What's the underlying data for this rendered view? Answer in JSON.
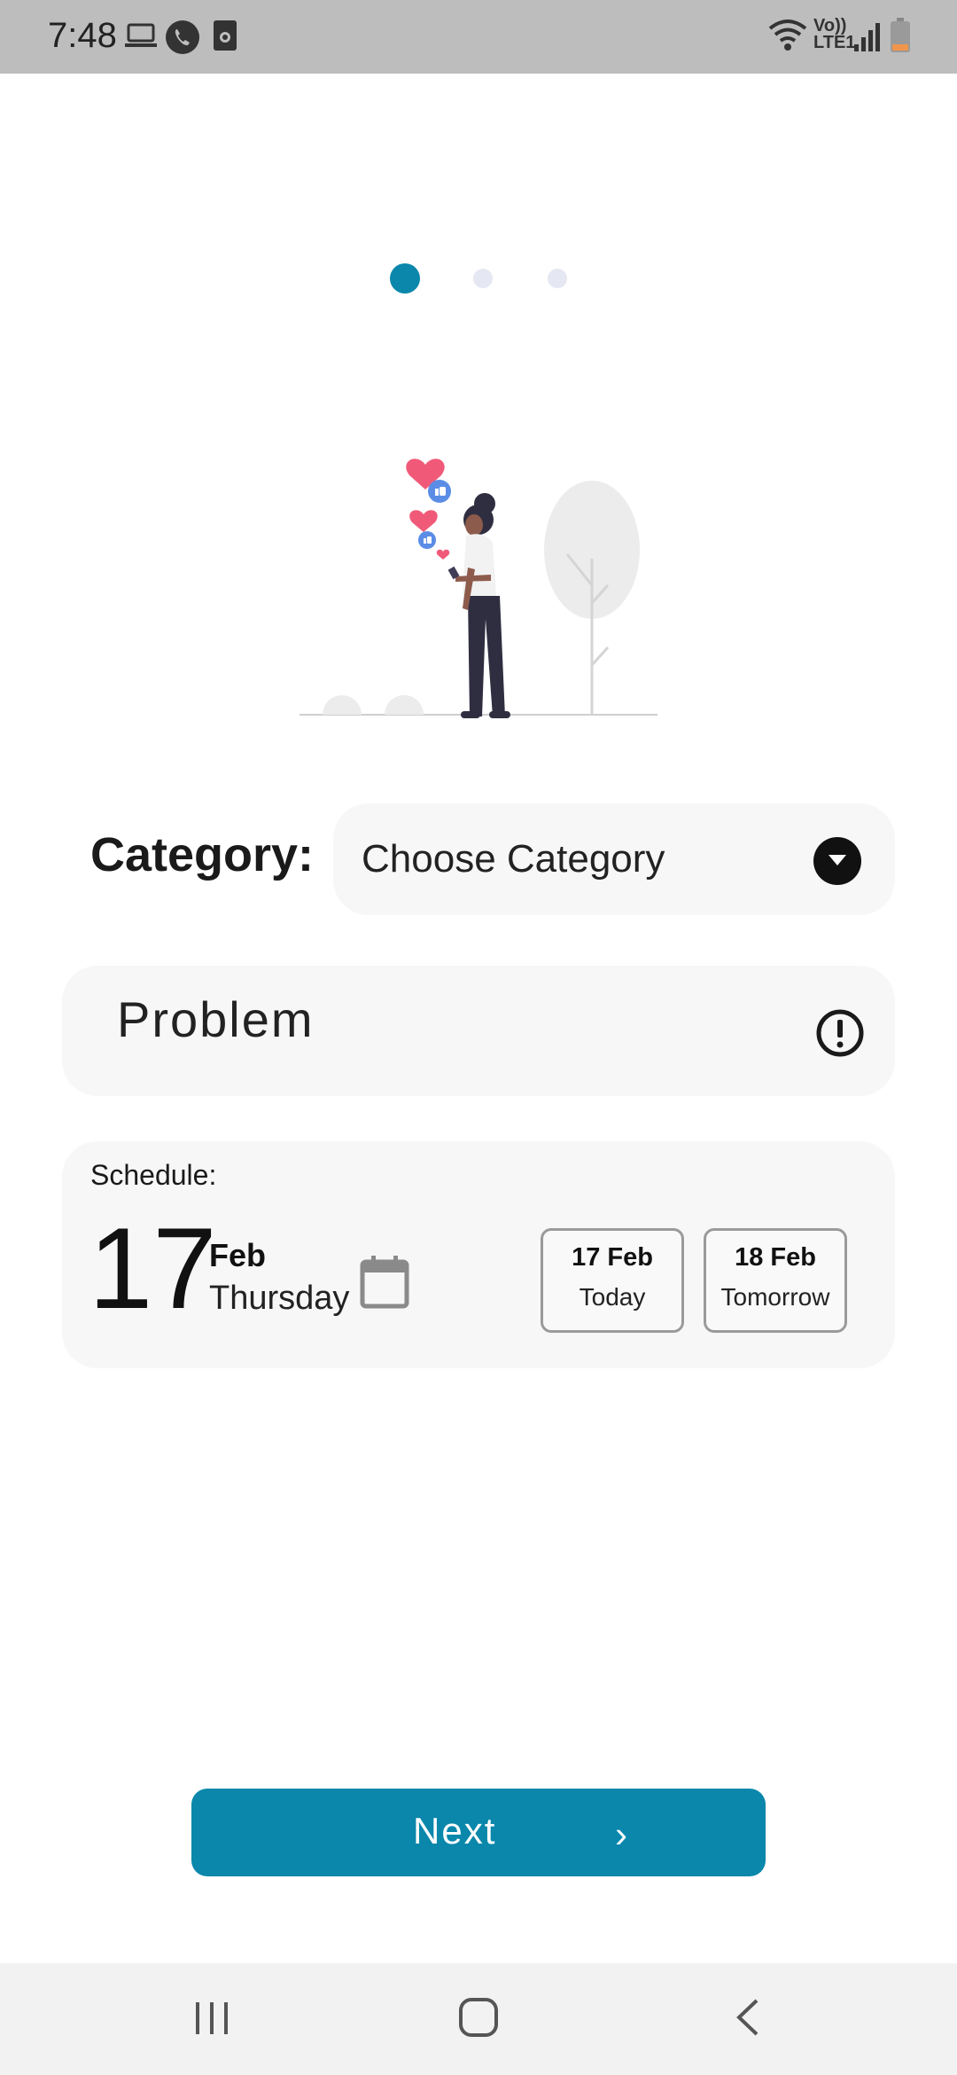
{
  "status_bar": {
    "time": "7:48",
    "left_icons": [
      "laptop-icon",
      "phone-call-icon",
      "sim-icon"
    ],
    "right_icons": [
      "wifi-icon",
      "volte-icon",
      "signal-icon",
      "battery-icon"
    ],
    "network_label": "Vo))\nLTE1"
  },
  "pager": {
    "pages": 3,
    "active_index": 0,
    "active_color": "#0a87ab",
    "inactive_color": "#e5e7f2"
  },
  "illustration": {
    "name": "person-with-phone-likes-illustration"
  },
  "category": {
    "label": "Category:",
    "selected": "Choose Category",
    "icon": "dropdown-arrow-icon"
  },
  "problem": {
    "placeholder": "Problem",
    "icon": "alert-circle-icon"
  },
  "schedule": {
    "label": "Schedule:",
    "day": "17",
    "month": "Feb",
    "weekday": "Thursday",
    "icon": "calendar-icon",
    "options": [
      {
        "date": "17 Feb",
        "label": "Today"
      },
      {
        "date": "18 Feb",
        "label": "Tomorrow"
      }
    ]
  },
  "next_button": {
    "label": "Next",
    "arrow": "›",
    "color": "#0a87ab"
  },
  "nav_bar": {
    "buttons": [
      "recent-apps-icon",
      "home-icon",
      "back-icon"
    ]
  }
}
